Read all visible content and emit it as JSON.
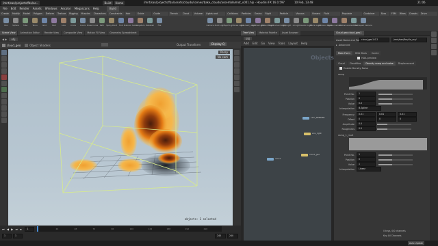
{
  "system": {
    "tasks": [
      "/mnt/san/projects/fbx/as...",
      "Build",
      "Home"
    ],
    "title": "/mnt/san/projects/fbx/assets/clouds/scenes/bake_clouds/assemble/mot_v001.hip - Houdini FX 16.0.597",
    "clock": "10 Feb, 13:48",
    "time_right": "21:06"
  },
  "menu": [
    "File",
    "Edit",
    "Render",
    "Assets",
    "Windows",
    "Aecolor",
    "Megascans",
    "Help",
    "Build"
  ],
  "shelf": {
    "tabs": [
      "Create",
      "Modify",
      "Model",
      "Polygon",
      "Deform",
      "Texture",
      "Rigging",
      "Muscles",
      "Characters",
      "Constraints",
      "Hair Utils",
      "Guide Process",
      "Guide Brushes",
      "Terrain FX",
      "Cloud FX",
      "Volume",
      "Lights and Cameras",
      "Collisions",
      "Particles",
      "Grains",
      "Rigid Bodies",
      "Particle Fluids",
      "Viscous Fluids",
      "Oceans",
      "Fluid Containers",
      "Populate Containers",
      "Container Tools",
      "Pyro FX",
      "FEM",
      "Wires",
      "Crowds",
      "Drive Simulation"
    ],
    "tools": [
      "Box",
      "Sphere",
      "Tube",
      "Torus",
      "Grid",
      "Null",
      "Line",
      "Circle",
      "Curve",
      "Draw Curve",
      "Path",
      "Spray Paint",
      "Font",
      "Platonic Solids",
      "L-System",
      "Metaball",
      "File"
    ],
    "light_tools": [
      "Camera",
      "Point Light",
      "Spot Light",
      "Area Light",
      "Geometry Light",
      "Volume Light",
      "Distant Light",
      "Environment Light",
      "Sky Light",
      "GI Light",
      "Caustic Light",
      "Portal Light",
      "Ambient Light",
      "Stereo Camera",
      "VR Camera",
      "Switcher",
      "Gamepad Camera"
    ]
  },
  "left_tabs": [
    "Scene View",
    "Animation Editor",
    "Render View",
    "Composite View",
    "Motion FX View",
    "Geometry Spreadsheet"
  ],
  "viewport": {
    "path": "obj",
    "cam_label": "cloud_geo",
    "toolbar": [
      "Object Shaders"
    ],
    "view_transform": "Output Transform",
    "display_label": "Display Q",
    "persp": "Persp",
    "cam_name": "No cam",
    "status_text": "objects: 1 selected",
    "accent_box": "#d8ec8a"
  },
  "timeline": {
    "start": "1",
    "end": "240",
    "current": "1",
    "frame_field": "1",
    "end_field": "240",
    "end_field2": "240",
    "marks": [
      "24",
      "48",
      "72",
      "96",
      "120",
      "144",
      "168",
      "192",
      "216"
    ]
  },
  "network_tabs": [
    "Tree View",
    "Material Palette",
    "Asset Browser"
  ],
  "network": {
    "path": "obj",
    "menu": [
      "Add",
      "Edit",
      "Go",
      "View",
      "Tools",
      "Layout",
      "Help"
    ],
    "label": "Objects",
    "nodes": [
      {
        "name": "cam_RENDER",
        "color": "#7aa5c8"
      },
      {
        "name": "env_light",
        "color": "#d8c06a"
      },
      {
        "name": "cloud_geo",
        "color": "#d8c06a"
      },
      {
        "name": "cloud",
        "color": "#7aa5c8"
      }
    ]
  },
  "params": {
    "header": "Cloud geo  cloud_geo1",
    "asset_label": "Asset Name and Path",
    "asset_value": "cloud_geo1.0.2",
    "asset_path": "/mnt/san/fbx/clo_sss/",
    "advanced": "Advanced",
    "tabs1": [
      "Main Form",
      "HDA Stats",
      "Cache"
    ],
    "hda_preview": "HDA preview",
    "tabs2": [
      "Cloud",
      "Cloudfiles",
      "Density ramp and noise",
      "Displacement"
    ],
    "enable": "Enable Density Noise",
    "ramp_label": "ramp",
    "ramp2_label": "ramp_1_mult",
    "fields": [
      {
        "label": "Point No.",
        "value": "1"
      },
      {
        "label": "Position",
        "value": "0"
      },
      {
        "label": "Value",
        "value": "0.0"
      }
    ],
    "interp_label": "Interpolation",
    "interp_value": "B-Spline",
    "noise": [
      {
        "label": "Frequency",
        "v1": "0.01",
        "v2": "0.01",
        "v3": "0.01"
      },
      {
        "label": "Offset",
        "v1": "0",
        "v2": "0",
        "v3": "0"
      },
      {
        "label": "Amplitude",
        "v1": "0.0",
        "v2": "",
        "": ""
      },
      {
        "label": "Roughness",
        "v1": "0.5",
        "v2": "",
        "v3": ""
      }
    ],
    "fields2": [
      {
        "label": "Point No.",
        "value": "1"
      },
      {
        "label": "Position",
        "value": "0"
      },
      {
        "label": "Value",
        "value": "1"
      }
    ],
    "interp2_value": "Linear"
  },
  "bottom": {
    "left": "",
    "right": "Auto Update",
    "keys": "0 keys, 0/0 channels",
    "key_all": "Key All Channels"
  }
}
